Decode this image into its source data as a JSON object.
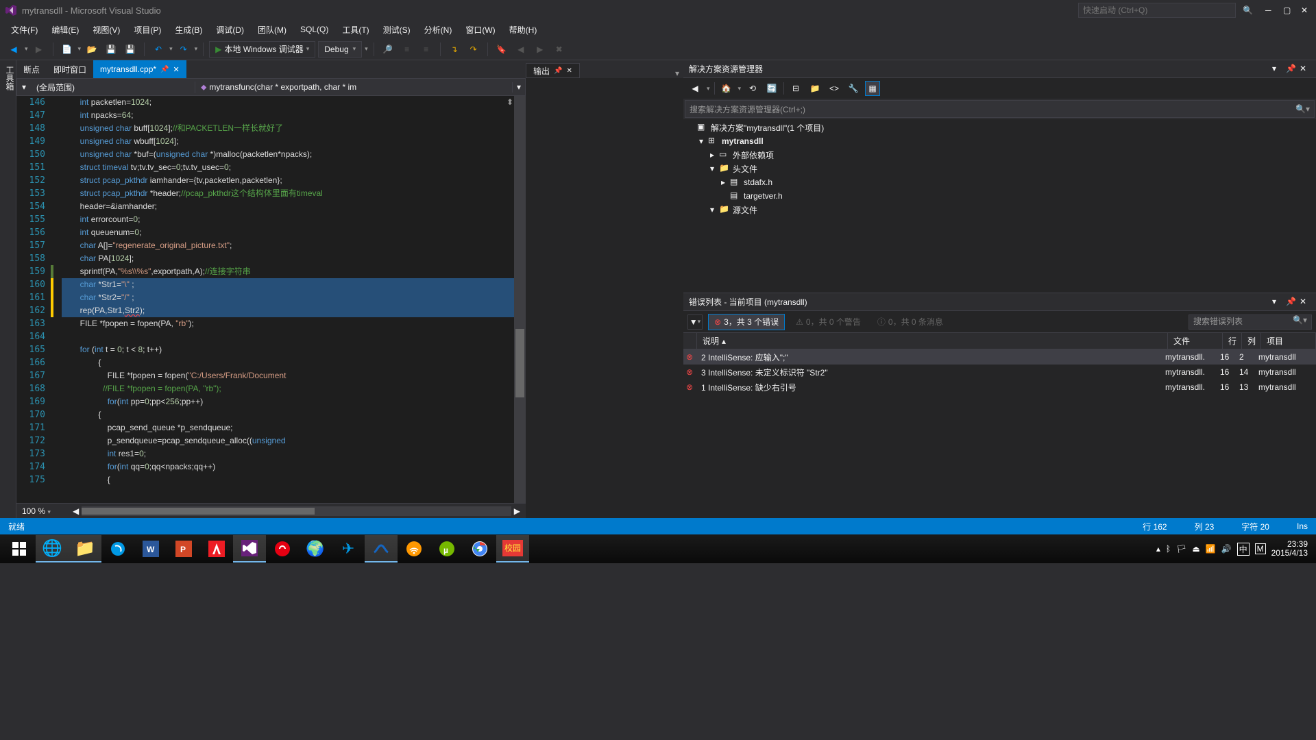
{
  "title": "mytransdll - Microsoft Visual Studio",
  "quick_launch_placeholder": "快速启动 (Ctrl+Q)",
  "menu": [
    "文件(F)",
    "编辑(E)",
    "视图(V)",
    "项目(P)",
    "生成(B)",
    "调试(D)",
    "团队(M)",
    "SQL(Q)",
    "工具(T)",
    "测试(S)",
    "分析(N)",
    "窗口(W)",
    "帮助(H)"
  ],
  "toolbar": {
    "start": "本地 Windows 调试器",
    "config": "Debug"
  },
  "doc_tabs": [
    "断点",
    "即时窗口"
  ],
  "active_tab": "mytransdll.cpp*",
  "nav": {
    "scope": "(全局范围)",
    "member": "mytransfunc(char * exportpath, char * im"
  },
  "code_lines": [
    {
      "n": 146,
      "m": "",
      "h": "        <span class='kw'>int</span> packetlen=<span class='num'>1024</span>;"
    },
    {
      "n": 147,
      "m": "",
      "h": "        <span class='kw'>int</span> npacks=<span class='num'>64</span>;"
    },
    {
      "n": 148,
      "m": "",
      "h": "        <span class='kw'>unsigned</span> <span class='kw'>char</span> buff[<span class='num'>1024</span>];<span class='cm'>//和PACKETLEN一样长就好了</span>"
    },
    {
      "n": 149,
      "m": "",
      "h": "        <span class='kw'>unsigned</span> <span class='kw'>char</span> wbuff[<span class='num'>1024</span>];"
    },
    {
      "n": 150,
      "m": "",
      "h": "        <span class='kw'>unsigned</span> <span class='kw'>char</span> *buf=(<span class='kw'>unsigned</span> <span class='kw'>char</span> *)malloc(packetlen*npacks);"
    },
    {
      "n": 151,
      "m": "",
      "h": "        <span class='kw'>struct</span> <span class='ty'>timeval</span> tv;tv.tv_sec=<span class='num'>0</span>;tv.tv_usec=<span class='num'>0</span>;"
    },
    {
      "n": 152,
      "m": "",
      "h": "        <span class='kw'>struct</span> <span class='ty'>pcap_pkthdr</span> iamhander={tv,packetlen,packetlen};"
    },
    {
      "n": 153,
      "m": "",
      "h": "        <span class='kw'>struct</span> <span class='ty'>pcap_pkthdr</span> *header;<span class='cm'>//pcap_pkthdr这个结构体里面有timeval</span>"
    },
    {
      "n": 154,
      "m": "",
      "h": "        header=&amp;iamhander;"
    },
    {
      "n": 155,
      "m": "",
      "h": "        <span class='kw'>int</span> errorcount=<span class='num'>0</span>;"
    },
    {
      "n": 156,
      "m": "",
      "h": "        <span class='kw'>int</span> queuenum=<span class='num'>0</span>;"
    },
    {
      "n": 157,
      "m": "",
      "h": "        <span class='kw'>char</span> A[]=<span class='str'>\"regenerate_original_picture.txt\"</span>;"
    },
    {
      "n": 158,
      "m": "",
      "h": "        <span class='kw'>char</span> PA[<span class='num'>1024</span>];"
    },
    {
      "n": 159,
      "m": "green",
      "h": "        sprintf(PA,<span class='str'>\"%s\\\\%s\"</span>,exportpath,A);<span class='cm'>//连接字符串</span>"
    },
    {
      "n": 160,
      "m": "yellow",
      "sel": true,
      "h": "        <span class='kw'>char</span> *Str1=<span class='str'>\"\\\"</span> ;"
    },
    {
      "n": 161,
      "m": "yellow",
      "sel": true,
      "h": "        <span class='kw'>char</span> *Str2=<span class='str'>\"/\"</span> ;"
    },
    {
      "n": 162,
      "m": "yellow",
      "sel": true,
      "h": "        rep(PA,Str1,<span class='err'>Str2</span>);"
    },
    {
      "n": 163,
      "m": "",
      "h": "        FILE *fpopen = fopen(PA, <span class='str'>\"rb\"</span>);"
    },
    {
      "n": 164,
      "m": "",
      "h": ""
    },
    {
      "n": 165,
      "m": "",
      "h": "        <span class='kw'>for</span> (<span class='kw'>int</span> t = <span class='num'>0</span>; t &lt; <span class='num'>8</span>; t++)"
    },
    {
      "n": 166,
      "m": "",
      "h": "                {"
    },
    {
      "n": 167,
      "m": "",
      "h": "                    FILE *fpopen = fopen(<span class='str'>\"C:/Users/Frank/Document</span>"
    },
    {
      "n": 168,
      "m": "",
      "h": "                  <span class='cm'>//FILE *fpopen = fopen(PA, \"rb\");</span>"
    },
    {
      "n": 169,
      "m": "",
      "h": "                    <span class='kw'>for</span>(<span class='kw'>int</span> pp=<span class='num'>0</span>;pp&lt;<span class='num'>256</span>;pp++)"
    },
    {
      "n": 170,
      "m": "",
      "h": "                {"
    },
    {
      "n": 171,
      "m": "",
      "h": "                    pcap_send_queue *p_sendqueue;"
    },
    {
      "n": 172,
      "m": "",
      "h": "                    p_sendqueue=pcap_sendqueue_alloc((<span class='kw'>unsigned</span>"
    },
    {
      "n": 173,
      "m": "",
      "h": "                    <span class='kw'>int</span> res1=<span class='num'>0</span>;"
    },
    {
      "n": 174,
      "m": "",
      "h": "                    <span class='kw'>for</span>(<span class='kw'>int</span> qq=<span class='num'>0</span>;qq&lt;npacks;qq++)"
    },
    {
      "n": 175,
      "m": "",
      "h": "                    {"
    }
  ],
  "zoom": "100 %",
  "output_tab": "输出",
  "sol_explorer": {
    "title": "解决方案资源管理器",
    "search_placeholder": "搜索解决方案资源管理器(Ctrl+;)",
    "nodes": [
      {
        "d": 0,
        "exp": "",
        "icon": "sln",
        "label": "解决方案\"mytransdll\"(1 个项目)"
      },
      {
        "d": 1,
        "exp": "▾",
        "icon": "proj",
        "label": "mytransdll",
        "bold": true
      },
      {
        "d": 2,
        "exp": "▸",
        "icon": "ref",
        "label": "外部依赖项"
      },
      {
        "d": 2,
        "exp": "▾",
        "icon": "folder",
        "label": "头文件"
      },
      {
        "d": 3,
        "exp": "▸",
        "icon": "h",
        "label": "stdafx.h"
      },
      {
        "d": 3,
        "exp": "",
        "icon": "h",
        "label": "targetver.h"
      },
      {
        "d": 2,
        "exp": "▾",
        "icon": "folder",
        "label": "源文件"
      }
    ]
  },
  "error_list": {
    "title": "错误列表 - 当前项目 (mytransdll)",
    "errors": "3，共 3 个错误",
    "warnings": "0，共 0 个警告",
    "messages": "0，共 0 条消息",
    "search_placeholder": "搜索错误列表",
    "cols": {
      "desc": "说明",
      "file": "文件",
      "line": "行",
      "col": "列",
      "proj": "项目"
    },
    "rows": [
      {
        "sel": true,
        "desc": "2 IntelliSense: 应输入\";\"",
        "file": "mytransdll.",
        "line": "16",
        "col": "2",
        "proj": "mytransdll"
      },
      {
        "desc": "3 IntelliSense: 未定义标识符 \"Str2\"",
        "file": "mytransdll.",
        "line": "16",
        "col": "14",
        "proj": "mytransdll"
      },
      {
        "desc": "1 IntelliSense: 缺少右引号",
        "file": "mytransdll.",
        "line": "16",
        "col": "13",
        "proj": "mytransdll"
      }
    ]
  },
  "status": {
    "ready": "就绪",
    "line": "行 162",
    "col": "列 23",
    "char": "字符 20",
    "ins": "Ins"
  },
  "tray": {
    "time": "23:39",
    "date": "2015/4/13",
    "ime": "中"
  }
}
